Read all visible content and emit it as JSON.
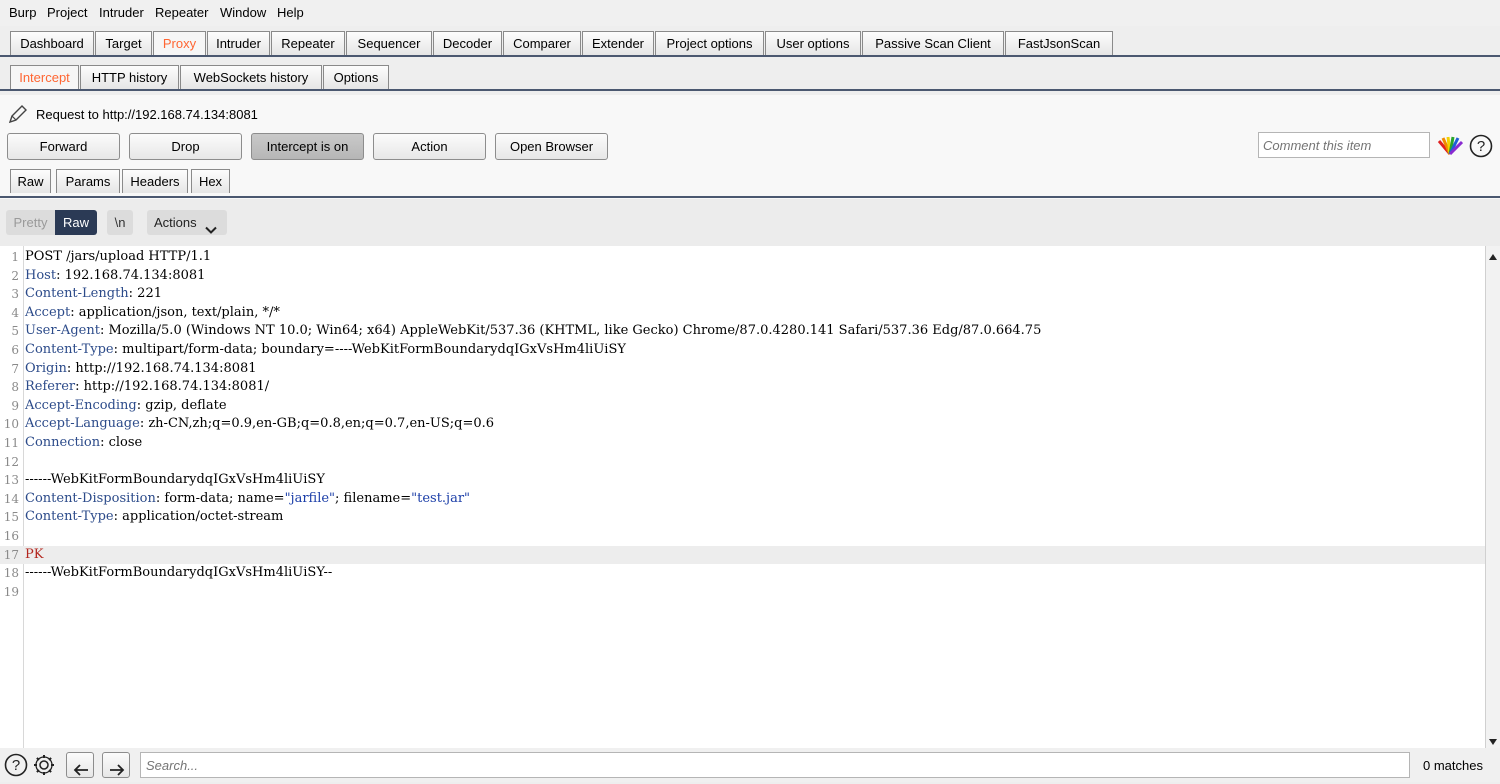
{
  "menu": [
    "Burp",
    "Project",
    "Intruder",
    "Repeater",
    "Window",
    "Help"
  ],
  "main_tabs": [
    "Dashboard",
    "Target",
    "Proxy",
    "Intruder",
    "Repeater",
    "Sequencer",
    "Decoder",
    "Comparer",
    "Extender",
    "Project options",
    "User options",
    "Passive Scan Client",
    "FastJsonScan"
  ],
  "main_active": "Proxy",
  "sub_tabs": [
    "Intercept",
    "HTTP history",
    "WebSockets history",
    "Options"
  ],
  "sub_active": "Intercept",
  "request_label": "Request to http://192.168.74.134:8081",
  "buttons": {
    "forward": "Forward",
    "drop": "Drop",
    "intercept": "Intercept is on",
    "action": "Action",
    "open_browser": "Open Browser"
  },
  "comment_placeholder": "Comment this item",
  "view_tabs": [
    "Raw",
    "Params",
    "Headers",
    "Hex"
  ],
  "editor_toolbar": {
    "pretty": "Pretty",
    "raw": "Raw",
    "newline": "\\n",
    "actions": "Actions"
  },
  "lines": [
    {
      "n": "1",
      "k": "",
      "v": "POST /jars/upload HTTP/1.1"
    },
    {
      "n": "2",
      "k": "Host",
      "v": ": 192.168.74.134:8081"
    },
    {
      "n": "3",
      "k": "Content-Length",
      "v": ": 221"
    },
    {
      "n": "4",
      "k": "Accept",
      "v": ": application/json, text/plain, */*"
    },
    {
      "n": "5",
      "k": "User-Agent",
      "v": ": Mozilla/5.0 (Windows NT 10.0; Win64; x64) AppleWebKit/537.36 (KHTML, like Gecko) Chrome/87.0.4280.141 Safari/537.36 Edg/87.0.664.75"
    },
    {
      "n": "6",
      "k": "Content-Type",
      "v": ": multipart/form-data; boundary=----WebKitFormBoundarydqIGxVsHm4liUiSY"
    },
    {
      "n": "7",
      "k": "Origin",
      "v": ": http://192.168.74.134:8081"
    },
    {
      "n": "8",
      "k": "Referer",
      "v": ": http://192.168.74.134:8081/"
    },
    {
      "n": "9",
      "k": "Accept-Encoding",
      "v": ": gzip, deflate"
    },
    {
      "n": "10",
      "k": "Accept-Language",
      "v": ": zh-CN,zh;q=0.9,en-GB;q=0.8,en;q=0.7,en-US;q=0.6"
    },
    {
      "n": "11",
      "k": "Connection",
      "v": ": close"
    },
    {
      "n": "12",
      "k": "",
      "v": ""
    },
    {
      "n": "13",
      "k": "",
      "v": "------WebKitFormBoundarydqIGxVsHm4liUiSY"
    },
    {
      "n": "14",
      "k": "Content-Disposition",
      "v": ": form-data; name=",
      "q1": "\"jarfile\"",
      "mid": "; filename=",
      "q2": "\"test.jar\""
    },
    {
      "n": "15",
      "k": "Content-Type",
      "v": ": application/octet-stream"
    },
    {
      "n": "16",
      "k": "",
      "v": ""
    },
    {
      "n": "17",
      "k": "",
      "v": "",
      "red": "PK"
    },
    {
      "n": "18",
      "k": "",
      "v": "------WebKitFormBoundarydqIGxVsHm4liUiSY--"
    },
    {
      "n": "19",
      "k": "",
      "v": ""
    }
  ],
  "search_placeholder": "Search...",
  "matches": "0 matches",
  "colors": {
    "accent": "#ff6633",
    "key": "#2c4b8a",
    "string": "#1b3ea8",
    "binary": "#b3261e",
    "divider": "#4b5870"
  }
}
